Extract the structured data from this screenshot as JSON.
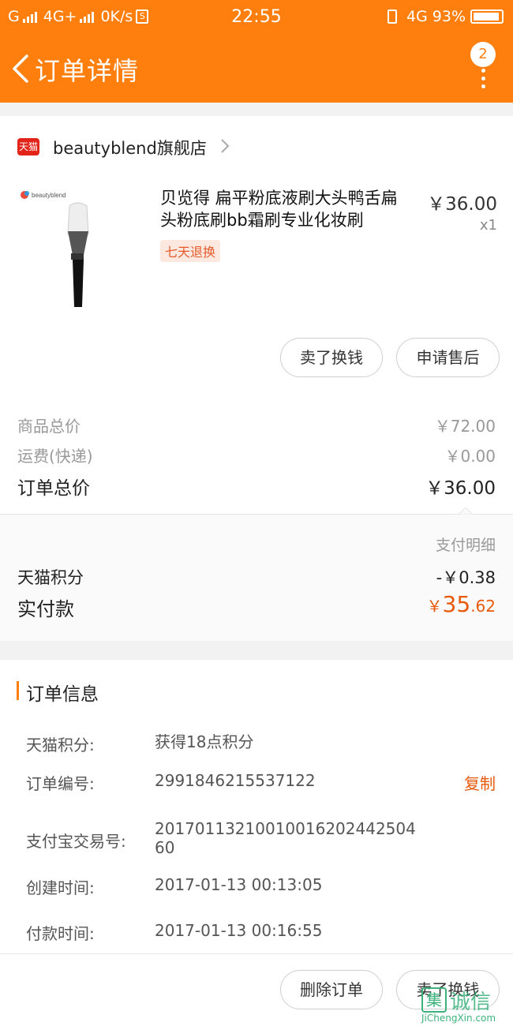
{
  "status_bar": {
    "carrier1": "G",
    "network": "4G+",
    "speed": "0K/s",
    "s_icon": "S",
    "time": "22:55",
    "network2": "4G",
    "battery": "93%"
  },
  "nav": {
    "title": "订单详情",
    "badge": "2"
  },
  "shop": {
    "logo_text": "天猫",
    "name": "beautyblend旗舰店"
  },
  "product": {
    "title": "贝览得 扁平粉底液刷大头鸭舌扁头粉底刷bb霜刷专业化妆刷",
    "tag": "七天退换",
    "price": "￥36.00",
    "qty": "x1",
    "brand_text": "beautyblend"
  },
  "actions1": {
    "sell_label": "卖了换钱",
    "after_sale_label": "申请售后"
  },
  "summary": {
    "goods_label": "商品总价",
    "goods_value": "￥72.00",
    "ship_label": "运费(快递)",
    "ship_value": "￥0.00",
    "total_label": "订单总价",
    "total_value": "￥36.00"
  },
  "payment": {
    "detail_label": "支付明细",
    "points_label": "天猫积分",
    "points_value": "-￥0.38",
    "actual_label": "实付款",
    "actual_currency": "￥",
    "actual_int": "35",
    "actual_dec": ".62"
  },
  "order_info": {
    "title": "订单信息",
    "rows": [
      {
        "label": "天猫积分:",
        "value": "获得18点积分"
      },
      {
        "label": "订单编号:",
        "value": "2991846215537122"
      },
      {
        "label": "支付宝交易号:",
        "value": "2017011321001001620244250460"
      },
      {
        "label": "创建时间:",
        "value": "2017-01-13 00:13:05"
      },
      {
        "label": "付款时间:",
        "value": "2017-01-13 00:16:55"
      }
    ],
    "copy_label": "复制"
  },
  "actions2": {
    "delete_label": "删除订单",
    "sell_label": "卖了换钱"
  },
  "watermark": {
    "char": "集",
    "text": "诚信",
    "url": "JiChengXin.com"
  },
  "colors": {
    "brand": "#ff7f0e",
    "price_accent": "#e8590c",
    "tmall_red": "#e2231a"
  }
}
